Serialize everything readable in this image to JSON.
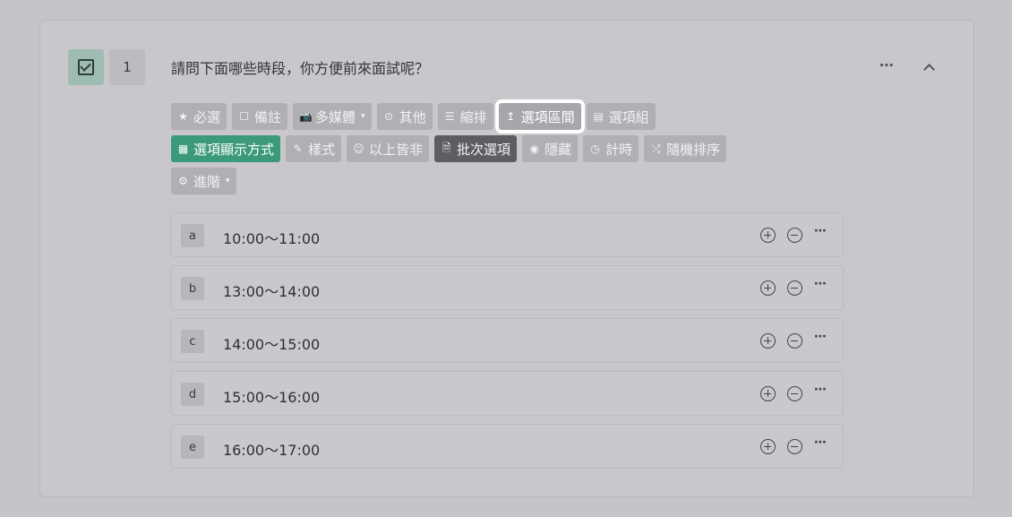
{
  "question": {
    "number": "1",
    "title": "請問下面哪些時段，你方便前來面試呢？",
    "more_icon": "⋯"
  },
  "toolbar": {
    "row1": [
      {
        "icon": "★",
        "label": "必選",
        "style": "normal"
      },
      {
        "icon": "☐",
        "label": "備註",
        "style": "normal"
      },
      {
        "icon": "📷",
        "label": "多媒體",
        "style": "normal",
        "caret": "▾"
      },
      {
        "icon": "⊙",
        "label": "其他",
        "style": "normal"
      },
      {
        "icon": "☰",
        "label": "縮排",
        "style": "normal"
      },
      {
        "icon": "↥",
        "label": "選項區間",
        "style": "highlight"
      },
      {
        "icon": "▤",
        "label": "選項組",
        "style": "normal"
      }
    ],
    "row2": [
      {
        "icon": "▦",
        "label": "選項顯示方式",
        "style": "green"
      },
      {
        "icon": "✎",
        "label": "樣式",
        "style": "normal"
      },
      {
        "icon": "☺",
        "label": "以上皆非",
        "style": "normal"
      },
      {
        "icon": "🗎",
        "label": "批次選項",
        "style": "dark"
      },
      {
        "icon": "◉",
        "label": "隱藏",
        "style": "normal"
      },
      {
        "icon": "◷",
        "label": "計時",
        "style": "normal"
      },
      {
        "icon": "⤮",
        "label": "隨機排序",
        "style": "normal"
      }
    ],
    "row3": [
      {
        "icon": "⚙",
        "label": "進階",
        "style": "normal",
        "caret": "▾"
      }
    ]
  },
  "options": [
    {
      "letter": "a",
      "text": "10:00～11:00"
    },
    {
      "letter": "b",
      "text": "13:00～14:00"
    },
    {
      "letter": "c",
      "text": "14:00～15:00"
    },
    {
      "letter": "d",
      "text": "15:00～16:00"
    },
    {
      "letter": "e",
      "text": "16:00～17:00"
    }
  ],
  "option_more_icon": "⋯",
  "colors": {
    "background": "#c6c4c8",
    "accent_green": "#3c9a7b",
    "button_gray": "#b1afb3",
    "button_dark": "#5f5d63",
    "highlight_border": "#ffffff"
  }
}
